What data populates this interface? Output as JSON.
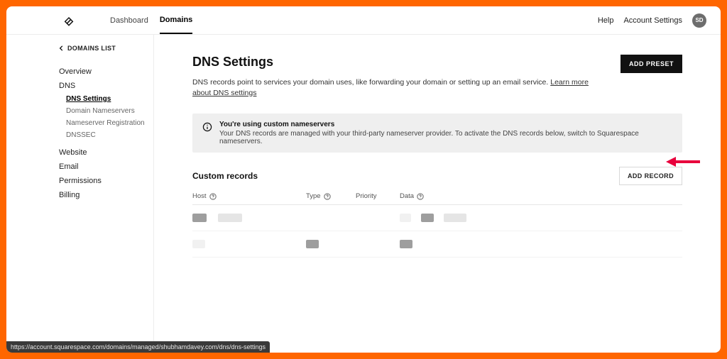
{
  "nav": {
    "dashboard": "Dashboard",
    "domains": "Domains",
    "help": "Help",
    "account_settings": "Account Settings",
    "avatar_initials": "SD"
  },
  "sidebar": {
    "back_label": "DOMAINS LIST",
    "overview": "Overview",
    "dns": "DNS",
    "sub": {
      "dns_settings": "DNS Settings",
      "domain_nameservers": "Domain Nameservers",
      "nameserver_registration": "Nameserver Registration",
      "dnssec": "DNSSEC"
    },
    "website": "Website",
    "email": "Email",
    "permissions": "Permissions",
    "billing": "Billing"
  },
  "page": {
    "title": "DNS Settings",
    "add_preset": "ADD PRESET",
    "desc_prefix": "DNS records point to services your domain uses, like forwarding your domain or setting up an email service. ",
    "learn_more": "Learn more about DNS settings"
  },
  "notice": {
    "title": "You're using custom nameservers",
    "body": "Your DNS records are managed with your third-party nameserver provider. To activate the DNS records below, switch to Squarespace nameservers."
  },
  "records": {
    "section_title": "Custom records",
    "add_record": "ADD RECORD",
    "columns": {
      "host": "Host",
      "type": "Type",
      "priority": "Priority",
      "data": "Data"
    }
  },
  "status_url": "https://account.squarespace.com/domains/managed/shubhamdavey.com/dns/dns-settings"
}
